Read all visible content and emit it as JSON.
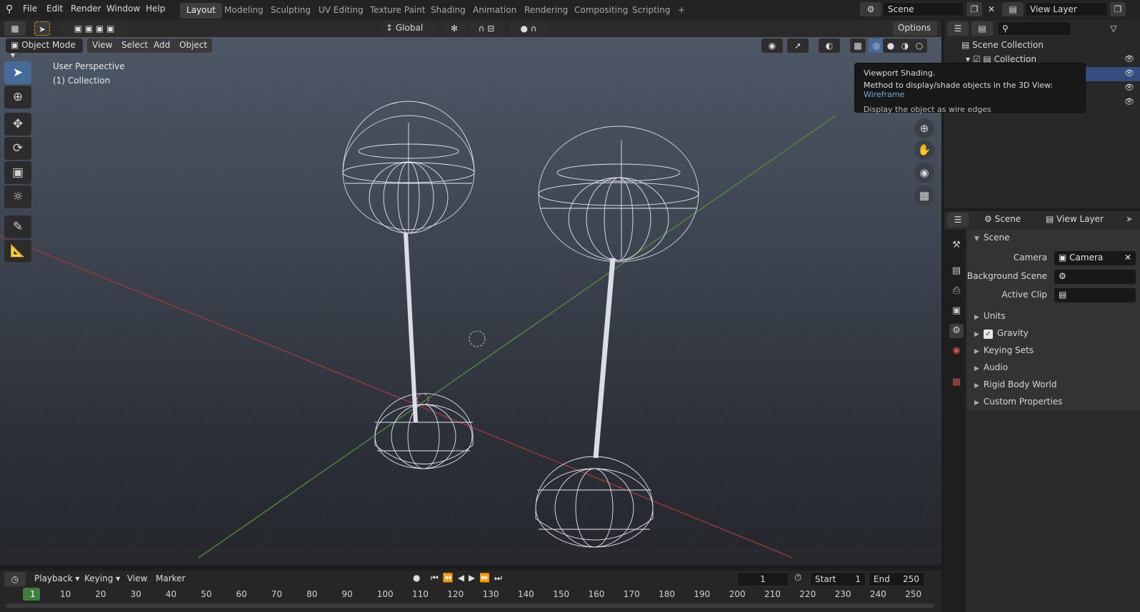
{
  "menubar": {
    "items": [
      "File",
      "Edit",
      "Render",
      "Window",
      "Help"
    ],
    "workspaces": [
      "Layout",
      "Modeling",
      "Sculpting",
      "UV Editing",
      "Texture Paint",
      "Shading",
      "Animation",
      "Rendering",
      "Compositing",
      "Scripting",
      "+"
    ],
    "active_workspace": "Layout",
    "scene": "Scene",
    "view_layer": "View Layer"
  },
  "toolbar": {
    "orientation": "Global",
    "options": "Options"
  },
  "viewport_header": {
    "mode": "Object Mode",
    "menus": [
      "View",
      "Select",
      "Add",
      "Object"
    ]
  },
  "viewport": {
    "perspective_label": "User Perspective",
    "collection_label": "(1) Collection",
    "shading": "Wireframe"
  },
  "tooltip": {
    "title": "Viewport Shading.",
    "description": "Method to display/shade objects in the 3D View:",
    "value": "Wireframe",
    "detail": "Display the object as wire edges"
  },
  "outliner": {
    "scene_collection": "Scene Collection",
    "collection": "Collection"
  },
  "properties": {
    "tabs": [
      "Scene",
      "View Layer"
    ],
    "section": "Scene",
    "camera_label": "Camera",
    "camera_value": "Camera",
    "background_scene_label": "Background Scene",
    "active_clip_label": "Active Clip",
    "panels": [
      "Units",
      "Gravity",
      "Keying Sets",
      "Audio",
      "Rigid Body World",
      "Custom Properties"
    ],
    "gravity_enabled": true
  },
  "timeline": {
    "menus": [
      "Playback",
      "Keying",
      "View",
      "Marker"
    ],
    "current_frame": "1",
    "start_label": "Start",
    "start": "1",
    "end_label": "End",
    "end": "250",
    "ruler": [
      "1",
      "10",
      "20",
      "30",
      "40",
      "50",
      "60",
      "70",
      "80",
      "90",
      "100",
      "110",
      "120",
      "130",
      "140",
      "150",
      "160",
      "170",
      "180",
      "190",
      "200",
      "210",
      "220",
      "230",
      "240",
      "250"
    ]
  }
}
